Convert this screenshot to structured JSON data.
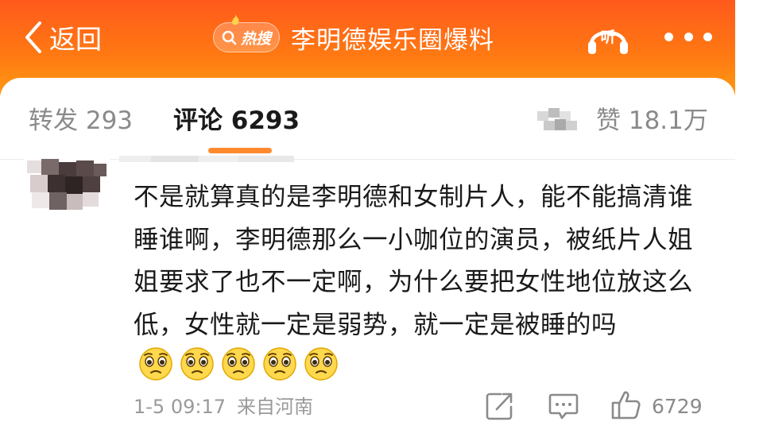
{
  "header": {
    "back_label": "返回",
    "hot_search_label": "热搜",
    "title": "李明德娱乐圈爆料",
    "listen_label": "听",
    "more_icon": "more-dots-icon"
  },
  "tabs": {
    "forward": "转发 293",
    "comment": "评论 6293",
    "like": "赞 18.1万"
  },
  "comment": {
    "text": "不是就算真的是李明德和女制片人，能不能搞清谁睡谁啊，李明德那么一小咖位的演员，被纸片人姐姐要求了也不一定啊，为什么要把女性地位放这么低，女性就一定是弱势，就一定是被睡的吗",
    "emoji_count": 5,
    "emoji_name": "pleading-face-emoji",
    "time": "1-5 09:17",
    "location": "来自河南",
    "like_count": "6729"
  },
  "colors": {
    "header_gradient_top": "#ff5a1c",
    "header_gradient_bottom": "#ff9a14",
    "tab_indicator": "#ff8a2e",
    "text_primary": "#1a1a1a",
    "text_secondary": "#8a8a8a"
  }
}
